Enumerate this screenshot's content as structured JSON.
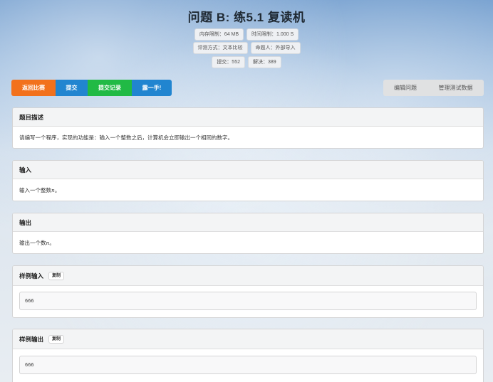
{
  "problem": {
    "title": "问题 B: 练5.1 复读机",
    "meta": {
      "memory": "内存限制：64 MB",
      "time": "时间限制：1.000 S",
      "judge": "评测方式：文本比较",
      "author": "命题人：外部导入",
      "submits": "提交：552",
      "solved": "解决：389"
    }
  },
  "actions": {
    "back": "返回比赛",
    "submit": "提交",
    "records": "提交记录",
    "show": "露一手!",
    "edit": "编辑问题",
    "manage_data": "管理测试数据"
  },
  "sections": {
    "description": {
      "heading": "题目描述",
      "text": "请编写一个程序，实现的功能是：输入一个整数之后，计算机会立即输出一个相同的数字。"
    },
    "input": {
      "heading": "输入",
      "text_before": "输入一个整数 ",
      "var": "n",
      "text_after": "。"
    },
    "output": {
      "heading": "输出",
      "text_before": "输出一个数 ",
      "var": "n",
      "text_after": "。"
    },
    "sample_input": {
      "heading": "样例输入",
      "copy_label": "复制",
      "value": "666"
    },
    "sample_output": {
      "heading": "样例输出",
      "copy_label": "复制",
      "value": "666"
    }
  },
  "colors": {
    "orange": "#f2711c",
    "blue": "#2185d0",
    "green": "#21ba45",
    "grey": "#e0e1e2"
  }
}
